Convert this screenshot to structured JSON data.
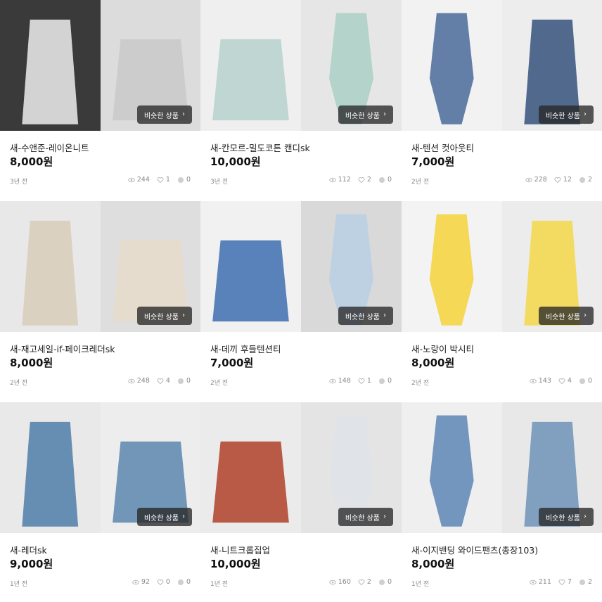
{
  "similar_label": "비슷한 상품",
  "icons": {
    "view": "eye-icon",
    "like": "heart-icon",
    "chat": "chat-bubble-icon",
    "chevron": "chevron-right-icon"
  },
  "products": [
    {
      "title": "새-수앤준-레이온니트",
      "price": "8,000원",
      "ago": "3년 전",
      "views": "244",
      "likes": "1",
      "chats": "0",
      "photos": [
        {
          "bg": "#3a3a3a",
          "fg": "#eeeeee"
        },
        {
          "bg": "#dcdcdc",
          "fg": "#c9c9c9"
        }
      ]
    },
    {
      "title": "새-칸모르-밀도코튼 캔디sk",
      "price": "10,000원",
      "ago": "3년 전",
      "views": "112",
      "likes": "2",
      "chats": "0",
      "photos": [
        {
          "bg": "#efefef",
          "fg": "#b7d1cc"
        },
        {
          "bg": "#e6e6e6",
          "fg": "#a9cfc6"
        }
      ]
    },
    {
      "title": "새-텐션 컷아웃티",
      "price": "7,000원",
      "ago": "2년 전",
      "views": "228",
      "likes": "12",
      "chats": "2",
      "photos": [
        {
          "bg": "#f2f2f2",
          "fg": "#4a6b9a"
        },
        {
          "bg": "#ededed",
          "fg": "#36517c"
        }
      ]
    },
    {
      "title": "새-재고세일-if-페이크레더sk",
      "price": "8,000원",
      "ago": "2년 전",
      "views": "248",
      "likes": "4",
      "chats": "0",
      "photos": [
        {
          "bg": "#e8e8e8",
          "fg": "#d8cdb8"
        },
        {
          "bg": "#dedede",
          "fg": "#e6dccb"
        }
      ]
    },
    {
      "title": "새-데끼 후들텐션티",
      "price": "7,000원",
      "ago": "2년 전",
      "views": "148",
      "likes": "1",
      "chats": "0",
      "photos": [
        {
          "bg": "#f1f1f1",
          "fg": "#3f6fb0"
        },
        {
          "bg": "#d9d9d9",
          "fg": "#b9cfe3"
        }
      ]
    },
    {
      "title": "새-노랑이 박시티",
      "price": "8,000원",
      "ago": "2년 전",
      "views": "143",
      "likes": "4",
      "chats": "0",
      "photos": [
        {
          "bg": "#f3f3f3",
          "fg": "#f3d23a"
        },
        {
          "bg": "#ececec",
          "fg": "#f4d84a"
        }
      ]
    },
    {
      "title": "새-레더sk",
      "price": "9,000원",
      "ago": "1년 전",
      "views": "92",
      "likes": "0",
      "chats": "0",
      "photos": [
        {
          "bg": "#e9e9e9",
          "fg": "#4f7ea8"
        },
        {
          "bg": "#ededed",
          "fg": "#5a86ad"
        }
      ]
    },
    {
      "title": "새-니트크롭집업",
      "price": "10,000원",
      "ago": "1년 전",
      "views": "160",
      "likes": "2",
      "chats": "0",
      "photos": [
        {
          "bg": "#ebebeb",
          "fg": "#b0412a"
        },
        {
          "bg": "#e4e4e4",
          "fg": "#dfe3e8"
        }
      ]
    },
    {
      "title": "새-이지밴딩 와이드팬츠(총장103)",
      "price": "8,000원",
      "ago": "1년 전",
      "views": "211",
      "likes": "7",
      "chats": "2",
      "photos": [
        {
          "bg": "#efefef",
          "fg": "#5d86b5"
        },
        {
          "bg": "#e8e8e8",
          "fg": "#6f93b9"
        }
      ]
    }
  ]
}
